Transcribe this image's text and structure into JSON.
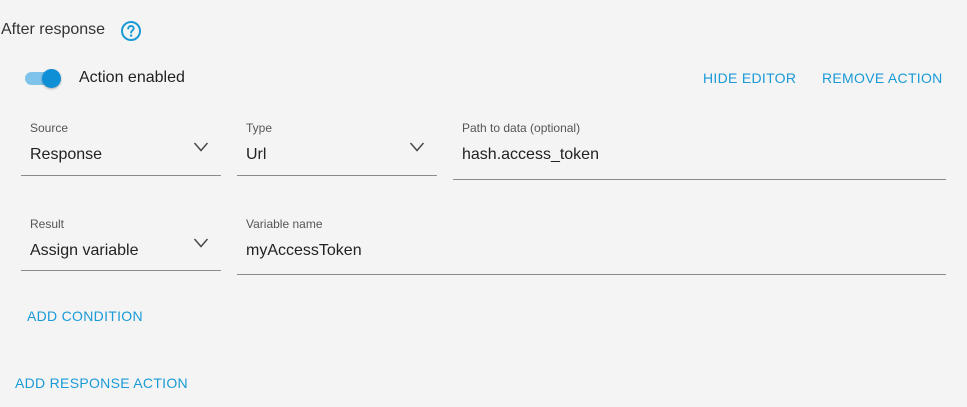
{
  "section": {
    "title": "After response"
  },
  "action": {
    "enabled_label": "Action enabled",
    "enabled": true,
    "hide_editor_label": "HIDE EDITOR",
    "remove_action_label": "REMOVE ACTION"
  },
  "fields": {
    "source": {
      "label": "Source",
      "value": "Response"
    },
    "type": {
      "label": "Type",
      "value": "Url"
    },
    "path": {
      "label": "Path to data (optional)",
      "value": "hash.access_token"
    },
    "result": {
      "label": "Result",
      "value": "Assign variable"
    },
    "variable": {
      "label": "Variable name",
      "value": "myAccessToken"
    }
  },
  "add_condition_label": "ADD CONDITION",
  "add_response_action_label": "ADD RESPONSE ACTION",
  "colors": {
    "accent": "#1a9ad6",
    "toggle_thumb": "#0f8fd6",
    "toggle_track": "#7ec3ea",
    "background": "#f4f4f4"
  }
}
